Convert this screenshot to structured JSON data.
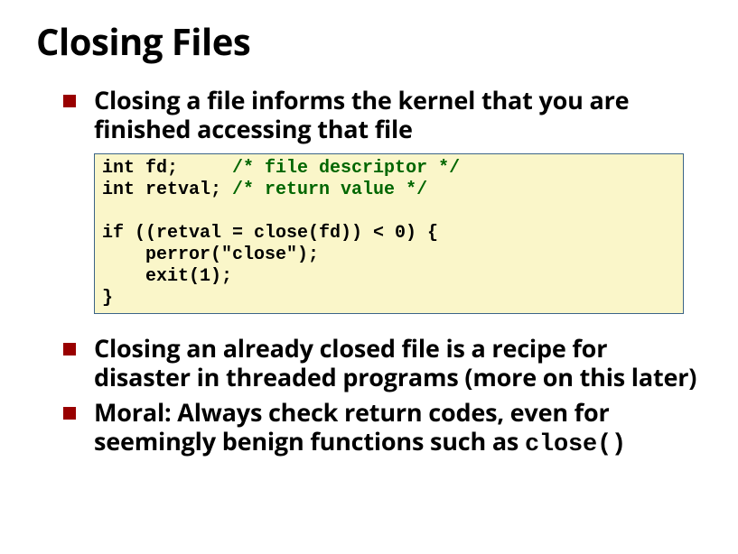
{
  "slide": {
    "title": "Closing Files",
    "accent_color": "#990000",
    "bullets": [
      {
        "text": "Closing a file informs the kernel that you are finished accessing that file"
      },
      {
        "text": "Closing an already closed file is a recipe for disaster in threaded programs (more on this later)"
      },
      {
        "moral_prefix": "Moral: Always check return codes, even for seemingly benign functions such as ",
        "moral_code": "close()"
      }
    ],
    "code": {
      "bg": "#faf6c9",
      "border": "#3b6487",
      "comment_color": "#006600",
      "line1a": "int fd;     ",
      "line1b": "/* file descriptor */",
      "line2a": "int retval; ",
      "line2b": "/* return value */",
      "blank": "",
      "line3": "if ((retval = close(fd)) < 0) {",
      "line4": "    perror(\"close\");",
      "line5": "    exit(1);",
      "line6": "}"
    }
  }
}
